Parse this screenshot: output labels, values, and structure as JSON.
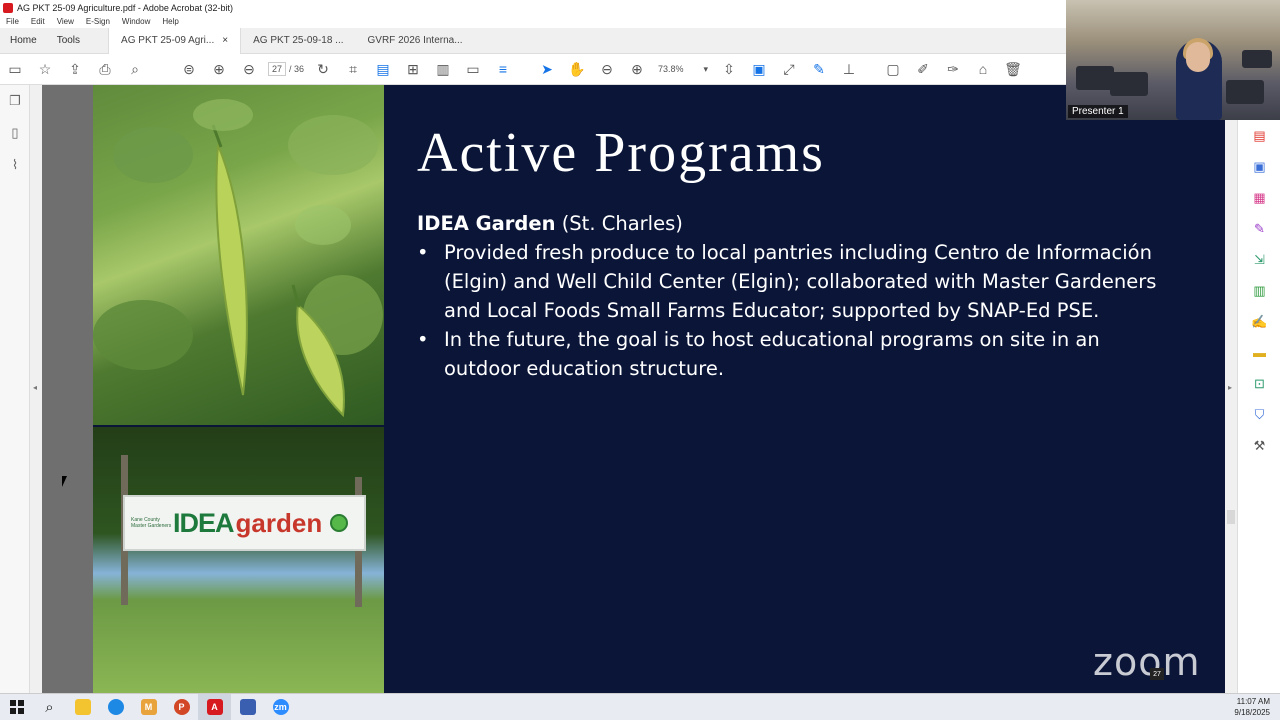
{
  "window": {
    "title": "AG PKT 25-09 Agriculture.pdf - Adobe Acrobat (32-bit)"
  },
  "menu": [
    "File",
    "Edit",
    "View",
    "E-Sign",
    "Window",
    "Help"
  ],
  "nav": {
    "home": "Home",
    "tools": "Tools"
  },
  "tabs": [
    {
      "label": "AG PKT 25-09 Agri...",
      "active": true,
      "close": "×"
    },
    {
      "label": "AG PKT 25-09-18 ..."
    },
    {
      "label": "GVRF 2026 Interna..."
    }
  ],
  "toolbar": {
    "page_current": "27",
    "page_total": "/ 36",
    "zoom": "73.8%"
  },
  "slide": {
    "title": "Active Programs",
    "heading_bold": "IDEA Garden",
    "heading_rest": " (St. Charles)",
    "bullets": [
      "Provided fresh produce to local pantries including Centro de Información (Elgin) and Well Child Center (Elgin); collaborated with Master Gardeners and Local Foods Small Farms Educator; supported by SNAP-Ed PSE.",
      "In the future, the goal is to host educational programs on site in an outdoor education structure."
    ],
    "sign": {
      "small_text": "Kane County Master Gardeners",
      "idea": "IDEA",
      "garden": "garden"
    }
  },
  "zoom_overlay": {
    "watermark": "zoom",
    "page_badge": "27"
  },
  "presenter": {
    "label": "Presenter 1"
  },
  "taskbar": {
    "time": "11:07 AM",
    "date": "9/18/2025"
  },
  "colors": {
    "slide_bg": "#0a1538",
    "accent_blue": "#1473e6",
    "acrobat_red": "#d71920"
  }
}
